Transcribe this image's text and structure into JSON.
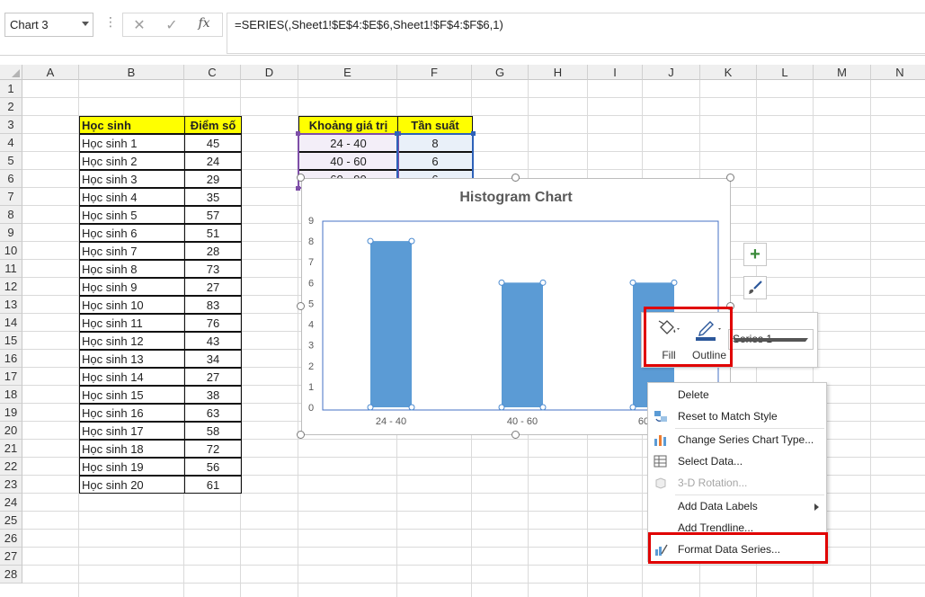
{
  "formula_bar": {
    "name_box": "Chart 3",
    "dots": "⋮",
    "cancel_icon": "✕",
    "enter_icon": "✓",
    "fx_label": "fx",
    "formula": "=SERIES(,Sheet1!$E$4:$E$6,Sheet1!$F$4:$F$6,1)"
  },
  "columns": [
    "A",
    "B",
    "C",
    "D",
    "E",
    "F",
    "G",
    "H",
    "I",
    "J",
    "K",
    "L",
    "M",
    "N"
  ],
  "rows": [
    "1",
    "2",
    "3",
    "4",
    "5",
    "6",
    "7",
    "8",
    "9",
    "10",
    "11",
    "12",
    "13",
    "14",
    "15",
    "16",
    "17",
    "18",
    "19",
    "20",
    "21",
    "22",
    "23",
    "24",
    "25",
    "26",
    "27",
    "28"
  ],
  "students_table": {
    "header": {
      "name": "Học sinh",
      "score": "Điểm số"
    },
    "rows": [
      {
        "name": "Học sinh 1",
        "score": "45"
      },
      {
        "name": "Học sinh 2",
        "score": "24"
      },
      {
        "name": "Học sinh 3",
        "score": "29"
      },
      {
        "name": "Học sinh 4",
        "score": "35"
      },
      {
        "name": "Học sinh 5",
        "score": "57"
      },
      {
        "name": "Học sinh 6",
        "score": "51"
      },
      {
        "name": "Học sinh 7",
        "score": "28"
      },
      {
        "name": "Học sinh 8",
        "score": "73"
      },
      {
        "name": "Học sinh 9",
        "score": "27"
      },
      {
        "name": "Học sinh 10",
        "score": "83"
      },
      {
        "name": "Học sinh 11",
        "score": "76"
      },
      {
        "name": "Học sinh 12",
        "score": "43"
      },
      {
        "name": "Học sinh 13",
        "score": "34"
      },
      {
        "name": "Học sinh 14",
        "score": "27"
      },
      {
        "name": "Học sinh 15",
        "score": "38"
      },
      {
        "name": "Học sinh 16",
        "score": "63"
      },
      {
        "name": "Học sinh 17",
        "score": "58"
      },
      {
        "name": "Học sinh 18",
        "score": "72"
      },
      {
        "name": "Học sinh 19",
        "score": "56"
      },
      {
        "name": "Học sinh 20",
        "score": "61"
      }
    ]
  },
  "freq_table": {
    "header": {
      "range": "Khoảng giá trị",
      "freq": "Tần suất"
    },
    "rows": [
      {
        "range": "24 - 40",
        "freq": "8"
      },
      {
        "range": "40 - 60",
        "freq": "6"
      },
      {
        "range": "60 - 90",
        "freq": "6"
      }
    ]
  },
  "chart_data": {
    "type": "bar",
    "title": "Histogram Chart",
    "categories": [
      "24 - 40",
      "40 - 60",
      "60 - 90"
    ],
    "values": [
      8,
      6,
      6
    ],
    "y_ticks": [
      "0",
      "1",
      "2",
      "3",
      "4",
      "5",
      "6",
      "7",
      "8",
      "9"
    ],
    "ylim": [
      0,
      9
    ],
    "bar_color": "#5b9bd5",
    "grid": false
  },
  "chart_buttons": {
    "add_element_icon": "+",
    "style_icon": "paintbrush"
  },
  "mini_toolbar": {
    "fill_label": "Fill",
    "outline_label": "Outline",
    "series_value": "Series 1"
  },
  "context_menu": {
    "items": [
      {
        "label": "Delete",
        "disabled": false
      },
      {
        "label": "Reset to Match Style",
        "disabled": false
      },
      {
        "label": "Change Series Chart Type...",
        "disabled": false
      },
      {
        "label": "Select Data...",
        "disabled": false
      },
      {
        "label": "3-D Rotation...",
        "disabled": true
      },
      {
        "label": "Add Data Labels",
        "disabled": false
      },
      {
        "label": "Add Trendline...",
        "disabled": false
      },
      {
        "label": "Format Data Series...",
        "disabled": false
      }
    ]
  },
  "highlight_color": "#e00000",
  "header_fill": "#ffff00"
}
